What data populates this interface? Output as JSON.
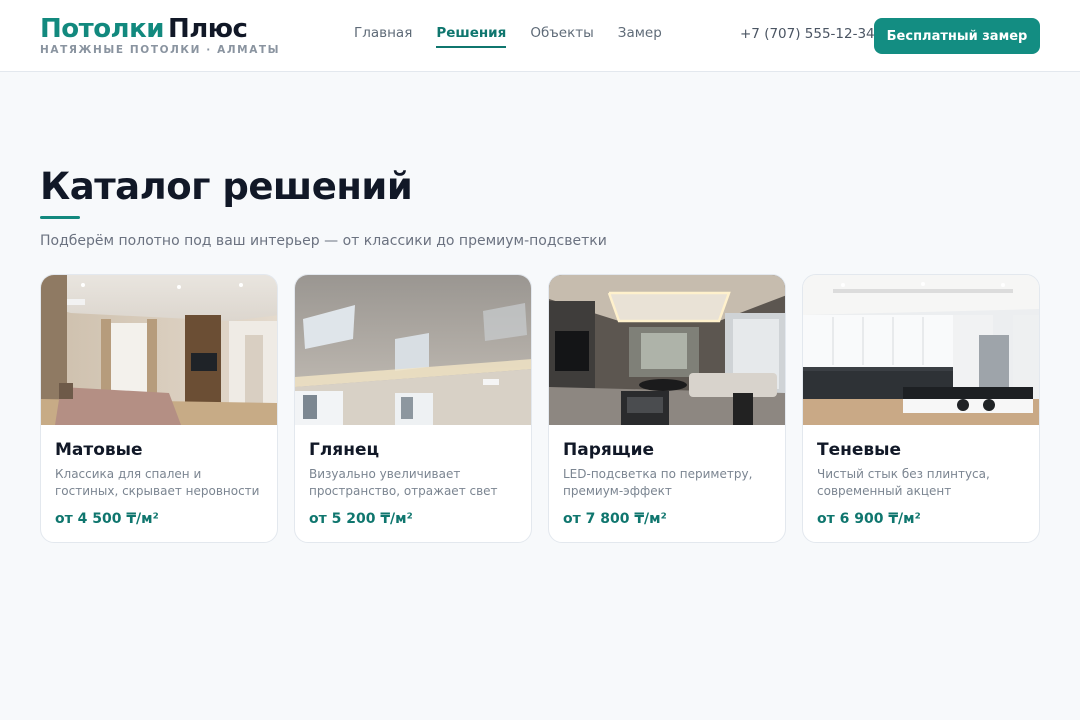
{
  "brand": {
    "name_part1": "Потолки",
    "name_part2": "Плюс",
    "tagline": "НАТЯЖНЫЕ ПОТОЛКИ · АЛМАТЫ"
  },
  "nav": {
    "items": [
      {
        "label": "Главная",
        "active": false
      },
      {
        "label": "Решения",
        "active": true
      },
      {
        "label": "Объекты",
        "active": false
      },
      {
        "label": "Замер",
        "active": false
      }
    ]
  },
  "header": {
    "phone": "+7 (707) 555-12-34",
    "cta_label": "Бесплатный замер"
  },
  "main": {
    "title": "Каталог решений",
    "subtitle": "Подберём полотно под ваш интерьер — от классики до премиум-подсветки"
  },
  "cards": [
    {
      "title": "Матовые",
      "desc": "Классика для спален и гостиных, скрывает неровности",
      "price": "от 4 500 ₸/м²"
    },
    {
      "title": "Глянец",
      "desc": "Визуально увеличивает пространство, отражает свет",
      "price": "от 5 200 ₸/м²"
    },
    {
      "title": "Парящие",
      "desc": "LED-подсветка по периметру, премиум-эффект",
      "price": "от 7 800 ₸/м²"
    },
    {
      "title": "Теневые",
      "desc": "Чистый стык без плинтуса, современный акцент",
      "price": "от 6 900 ₸/м²"
    }
  ],
  "colors": {
    "accent": "#12897e",
    "accent_dark": "#0f766e",
    "cta_bg": "#138d82",
    "text": "#111827",
    "muted": "#6b7280",
    "background": "#f7f9fb"
  }
}
